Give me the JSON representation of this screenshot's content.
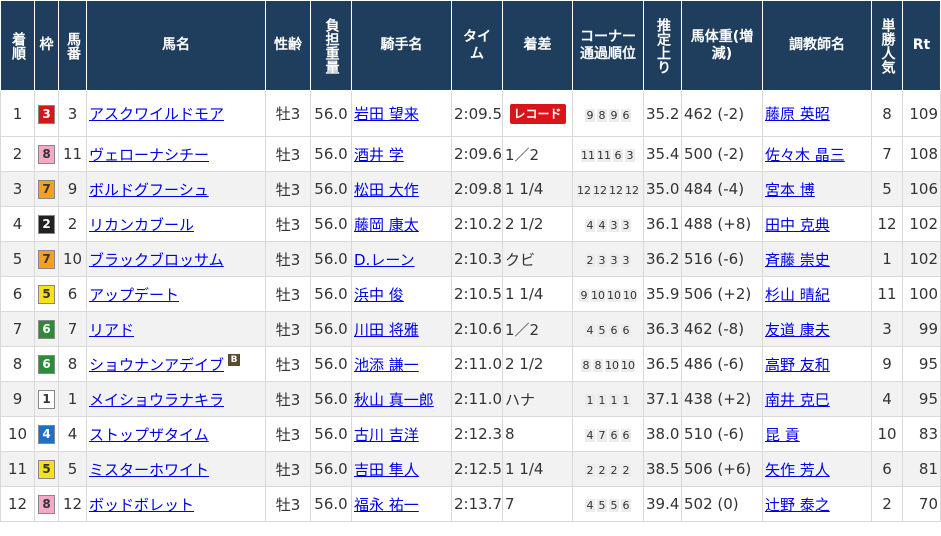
{
  "headers": {
    "rank": "着順",
    "waku": "枠",
    "umaban": "馬番",
    "horse": "馬名",
    "sexage": "性齢",
    "weight": "負担重量",
    "jockey": "騎手名",
    "time": "タイム",
    "margin": "着差",
    "corner": "コーナー通過順位",
    "last3f": "推定上り",
    "bodyweight": "馬体重(増減)",
    "trainer": "調教師名",
    "popularity": "単勝人気",
    "rt": "Rt"
  },
  "waku_colors": {
    "1": {
      "bg": "#ffffff",
      "fg": "#333333"
    },
    "2": {
      "bg": "#222222",
      "fg": "#ffffff"
    },
    "3": {
      "bg": "#d9141b",
      "fg": "#ffffff"
    },
    "4": {
      "bg": "#1e6fc8",
      "fg": "#ffffff"
    },
    "5": {
      "bg": "#f6e21a",
      "fg": "#333333"
    },
    "6": {
      "bg": "#2f8a3a",
      "fg": "#ffffff"
    },
    "7": {
      "bg": "#f5a020",
      "fg": "#333333"
    },
    "8": {
      "bg": "#f6a9c6",
      "fg": "#333333"
    }
  },
  "record_label": "レコード",
  "blinker_label": "B",
  "rows": [
    {
      "rank": "1",
      "waku": "3",
      "umaban": "3",
      "horse": "アスクワイルドモア",
      "blinker": false,
      "sexage": "牡3",
      "weight": "56.0",
      "jockey": "岩田 望来",
      "time": "2:09.5",
      "margin": "",
      "record": true,
      "corner": [
        "9",
        "8",
        "9",
        "6"
      ],
      "last3f": "35.2",
      "bodyweight": "462 (-2)",
      "trainer": "藤原 英昭",
      "popularity": "8",
      "rt": "109"
    },
    {
      "rank": "2",
      "waku": "8",
      "umaban": "11",
      "horse": "ヴェローナシチー",
      "blinker": false,
      "sexage": "牡3",
      "weight": "56.0",
      "jockey": "酒井 学",
      "time": "2:09.6",
      "margin": "1／2",
      "record": false,
      "corner": [
        "11",
        "11",
        "6",
        "3"
      ],
      "last3f": "35.4",
      "bodyweight": "500 (-2)",
      "trainer": "佐々木 晶三",
      "popularity": "7",
      "rt": "108"
    },
    {
      "rank": "3",
      "waku": "7",
      "umaban": "9",
      "horse": "ボルドグフーシュ",
      "blinker": false,
      "sexage": "牡3",
      "weight": "56.0",
      "jockey": "松田 大作",
      "time": "2:09.8",
      "margin": "1 1/4",
      "record": false,
      "corner": [
        "12",
        "12",
        "12",
        "12"
      ],
      "last3f": "35.0",
      "bodyweight": "484 (-4)",
      "trainer": "宮本 博",
      "popularity": "5",
      "rt": "106"
    },
    {
      "rank": "4",
      "waku": "2",
      "umaban": "2",
      "horse": "リカンカブール",
      "blinker": false,
      "sexage": "牡3",
      "weight": "56.0",
      "jockey": "藤岡 康太",
      "time": "2:10.2",
      "margin": "2 1/2",
      "record": false,
      "corner": [
        "4",
        "4",
        "3",
        "3"
      ],
      "last3f": "36.1",
      "bodyweight": "488 (+8)",
      "trainer": "田中 克典",
      "popularity": "12",
      "rt": "102"
    },
    {
      "rank": "5",
      "waku": "7",
      "umaban": "10",
      "horse": "ブラックブロッサム",
      "blinker": false,
      "sexage": "牡3",
      "weight": "56.0",
      "jockey": "D.レーン",
      "time": "2:10.3",
      "margin": "クビ",
      "record": false,
      "corner": [
        "2",
        "3",
        "3",
        "3"
      ],
      "last3f": "36.2",
      "bodyweight": "516 (-6)",
      "trainer": "斉藤 崇史",
      "popularity": "1",
      "rt": "102"
    },
    {
      "rank": "6",
      "waku": "5",
      "umaban": "6",
      "horse": "アップデート",
      "blinker": false,
      "sexage": "牡3",
      "weight": "56.0",
      "jockey": "浜中 俊",
      "time": "2:10.5",
      "margin": "1 1/4",
      "record": false,
      "corner": [
        "9",
        "10",
        "10",
        "10"
      ],
      "last3f": "35.9",
      "bodyweight": "506 (+2)",
      "trainer": "杉山 晴紀",
      "popularity": "11",
      "rt": "100"
    },
    {
      "rank": "7",
      "waku": "6",
      "umaban": "7",
      "horse": "リアド",
      "blinker": false,
      "sexage": "牡3",
      "weight": "56.0",
      "jockey": "川田 将雅",
      "time": "2:10.6",
      "margin": "1／2",
      "record": false,
      "corner": [
        "4",
        "5",
        "6",
        "6"
      ],
      "last3f": "36.3",
      "bodyweight": "462 (-8)",
      "trainer": "友道 康夫",
      "popularity": "3",
      "rt": "99"
    },
    {
      "rank": "8",
      "waku": "6",
      "umaban": "8",
      "horse": "ショウナンアデイブ",
      "blinker": true,
      "sexage": "牡3",
      "weight": "56.0",
      "jockey": "池添 謙一",
      "time": "2:11.0",
      "margin": "2 1/2",
      "record": false,
      "corner": [
        "8",
        "8",
        "10",
        "10"
      ],
      "last3f": "36.5",
      "bodyweight": "486 (-6)",
      "trainer": "高野 友和",
      "popularity": "9",
      "rt": "95"
    },
    {
      "rank": "9",
      "waku": "1",
      "umaban": "1",
      "horse": "メイショウラナキラ",
      "blinker": false,
      "sexage": "牡3",
      "weight": "56.0",
      "jockey": "秋山 真一郎",
      "time": "2:11.0",
      "margin": "ハナ",
      "record": false,
      "corner": [
        "1",
        "1",
        "1",
        "1"
      ],
      "last3f": "37.1",
      "bodyweight": "438 (+2)",
      "trainer": "南井 克巳",
      "popularity": "4",
      "rt": "95"
    },
    {
      "rank": "10",
      "waku": "4",
      "umaban": "4",
      "horse": "ストップザタイム",
      "blinker": false,
      "sexage": "牡3",
      "weight": "56.0",
      "jockey": "古川 吉洋",
      "time": "2:12.3",
      "margin": "8",
      "record": false,
      "corner": [
        "4",
        "7",
        "6",
        "6"
      ],
      "last3f": "38.0",
      "bodyweight": "510 (-6)",
      "trainer": "昆 貢",
      "popularity": "10",
      "rt": "83"
    },
    {
      "rank": "11",
      "waku": "5",
      "umaban": "5",
      "horse": "ミスターホワイト",
      "blinker": false,
      "sexage": "牡3",
      "weight": "56.0",
      "jockey": "吉田 隼人",
      "time": "2:12.5",
      "margin": "1 1/4",
      "record": false,
      "corner": [
        "2",
        "2",
        "2",
        "2"
      ],
      "last3f": "38.5",
      "bodyweight": "506 (+6)",
      "trainer": "矢作 芳人",
      "popularity": "6",
      "rt": "81"
    },
    {
      "rank": "12",
      "waku": "8",
      "umaban": "12",
      "horse": "ボッドボレット",
      "blinker": false,
      "sexage": "牡3",
      "weight": "56.0",
      "jockey": "福永 祐一",
      "time": "2:13.7",
      "margin": "7",
      "record": false,
      "corner": [
        "4",
        "5",
        "5",
        "6"
      ],
      "last3f": "39.4",
      "bodyweight": "502 (0)",
      "trainer": "辻野 泰之",
      "popularity": "2",
      "rt": "70"
    }
  ]
}
